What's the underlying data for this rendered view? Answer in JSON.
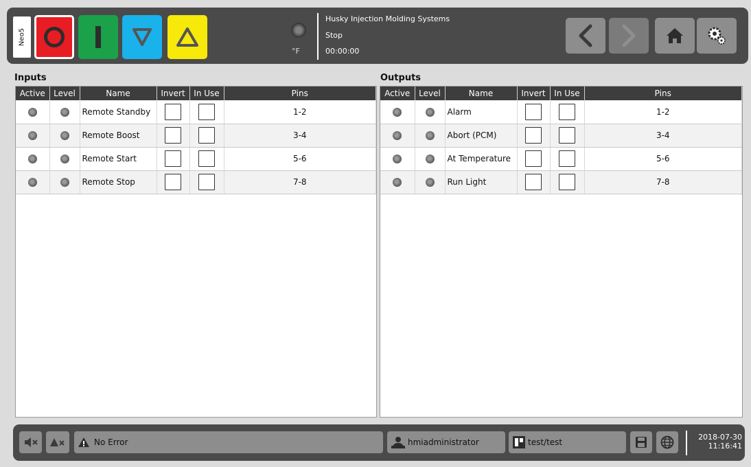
{
  "header": {
    "neo_tab": "Neo5",
    "temp_unit": "°F",
    "system_name": "Husky Injection Molding Systems",
    "machine_state": "Stop",
    "cycle_time": "00:00:00"
  },
  "inputs": {
    "title": "Inputs",
    "columns": [
      "Active",
      "Level",
      "Name",
      "Invert",
      "In Use",
      "Pins"
    ],
    "rows": [
      {
        "name": "Remote Standby",
        "pins": "1-2"
      },
      {
        "name": "Remote Boost",
        "pins": "3-4"
      },
      {
        "name": "Remote Start",
        "pins": "5-6"
      },
      {
        "name": "Remote Stop",
        "pins": "7-8"
      }
    ]
  },
  "outputs": {
    "title": "Outputs",
    "columns": [
      "Active",
      "Level",
      "Name",
      "Invert",
      "In Use",
      "Pins"
    ],
    "rows": [
      {
        "name": "Alarm",
        "pins": "1-2"
      },
      {
        "name": "Abort (PCM)",
        "pins": "3-4"
      },
      {
        "name": "At Temperature",
        "pins": "5-6"
      },
      {
        "name": "Run Light",
        "pins": "7-8"
      }
    ]
  },
  "footer": {
    "status": "No Error",
    "user": "hmiadministrator",
    "mold": "test/test",
    "date": "2018-07-30",
    "time": "11:16:41"
  },
  "colors": {
    "stop": "#e81d23",
    "start": "#1aa14a",
    "lower": "#1ab2ea",
    "raise": "#f7e90a",
    "bar": "#4a4a4a"
  },
  "icons": [
    "stop-icon",
    "start-icon",
    "down-triangle-icon",
    "up-triangle-icon",
    "temperature-led-icon",
    "back-arrow-icon",
    "forward-arrow-icon",
    "home-icon",
    "settings-gear-icon",
    "mute-icon",
    "alarm-ack-icon",
    "warning-icon",
    "user-icon",
    "mold-icon",
    "save-icon",
    "globe-icon"
  ]
}
